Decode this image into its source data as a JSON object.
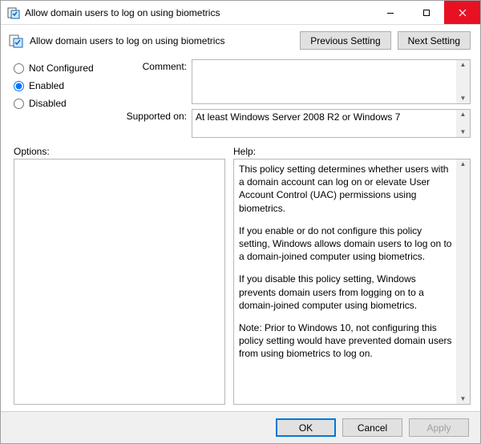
{
  "window": {
    "title": "Allow domain users to log on using biometrics"
  },
  "header": {
    "policy_title": "Allow domain users to log on using biometrics",
    "prev_label": "Previous Setting",
    "next_label": "Next Setting"
  },
  "state": {
    "not_configured_label": "Not Configured",
    "enabled_label": "Enabled",
    "disabled_label": "Disabled",
    "selected": "Enabled"
  },
  "fields": {
    "comment_label": "Comment:",
    "comment_value": "",
    "supported_label": "Supported on:",
    "supported_value": "At least Windows Server 2008 R2 or Windows 7"
  },
  "panes": {
    "options_label": "Options:",
    "help_label": "Help:"
  },
  "help": {
    "p1": "This policy setting determines whether users with a domain account can log on or elevate User Account Control (UAC) permissions using biometrics.",
    "p2": "If you enable or do not configure this policy setting, Windows allows domain users to log on to a domain-joined computer using biometrics.",
    "p3": "If you disable this policy setting, Windows prevents domain users from logging on to a domain-joined computer using biometrics.",
    "p4": "Note: Prior to Windows 10, not configuring this policy setting would have prevented domain users from using biometrics to log on."
  },
  "footer": {
    "ok": "OK",
    "cancel": "Cancel",
    "apply": "Apply"
  }
}
